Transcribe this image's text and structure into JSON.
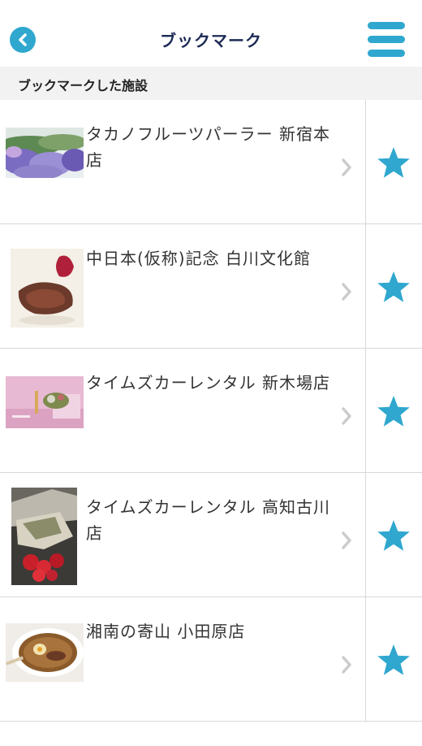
{
  "header": {
    "title": "ブックマーク",
    "back_icon": "back-arrow-icon",
    "menu_icon": "hamburger-menu-icon"
  },
  "section": {
    "title": "ブックマークした施設"
  },
  "colors": {
    "accent": "#2fa7cf",
    "title": "#1c2a55",
    "divider": "#d8d8d8",
    "section_bg": "#f2f2f2"
  },
  "bookmarks": [
    {
      "name": "タカノフルーツパーラー 新宿本店",
      "bookmarked": true
    },
    {
      "name": "中日本(仮称)記念 白川文化館",
      "bookmarked": true
    },
    {
      "name": "タイムズカーレンタル 新木場店",
      "bookmarked": true
    },
    {
      "name": "タイムズカーレンタル 高知古川店",
      "bookmarked": true
    },
    {
      "name": "湘南の寄山 小田原店",
      "bookmarked": true
    }
  ]
}
